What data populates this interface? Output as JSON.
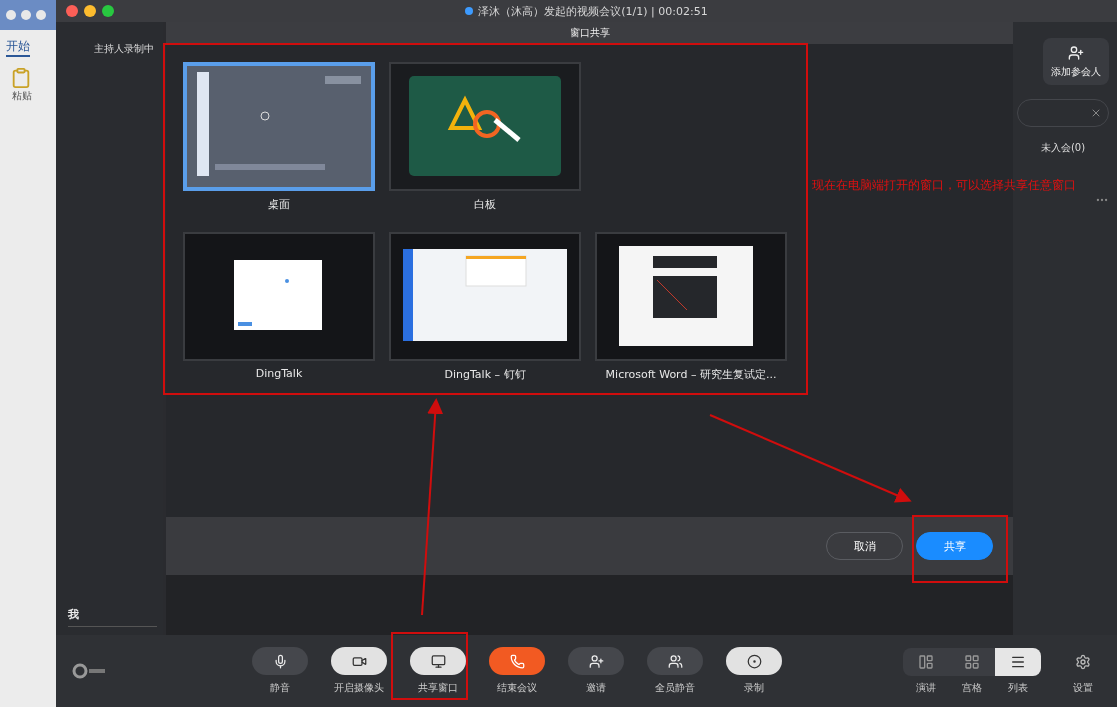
{
  "word_app": {
    "tab": "开始",
    "paste_label": "粘贴"
  },
  "window": {
    "title": "泽沐（沐高）发起的视频会议(1/1) | 00:02:51"
  },
  "left_pane": {
    "recording_status": "主持人录制中",
    "self_name": "我"
  },
  "share_dialog": {
    "title": "窗口共享",
    "sources": [
      {
        "label": "桌面",
        "kind": "desktop",
        "selected": true
      },
      {
        "label": "白板",
        "kind": "whiteboard",
        "selected": false
      },
      {
        "label": "DingTalk",
        "kind": "dialog",
        "selected": false
      },
      {
        "label": "DingTalk – 钉钉",
        "kind": "chat",
        "selected": false
      },
      {
        "label": "Microsoft Word – 研究生复试定...",
        "kind": "document",
        "selected": false
      }
    ],
    "buttons": [
      {
        "label": "取消",
        "kind": "secondary"
      },
      {
        "label": "共享",
        "kind": "primary"
      }
    ]
  },
  "participants_panel": {
    "add_button": "添加参会人",
    "tab": "未入会(0)"
  },
  "toolbar": {
    "controls": [
      {
        "label": "静音",
        "kind": "mute",
        "on": false
      },
      {
        "label": "开启摄像头",
        "kind": "camera",
        "on": true
      },
      {
        "label": "共享窗口",
        "kind": "share",
        "on": true
      },
      {
        "label": "结束会议",
        "kind": "end"
      },
      {
        "label": "邀请",
        "kind": "invite",
        "on": false
      },
      {
        "label": "全员静音",
        "kind": "mute_all",
        "on": false
      },
      {
        "label": "录制",
        "kind": "record",
        "on": true
      }
    ],
    "views": [
      {
        "label": "演讲",
        "kind": "speaker",
        "selected": false
      },
      {
        "label": "宫格",
        "kind": "grid",
        "selected": false
      },
      {
        "label": "列表",
        "kind": "list",
        "selected": true
      }
    ],
    "settings": "设置"
  },
  "annotation": {
    "note": "现在在电脑端打开的窗口，可以选择共享任意窗口"
  }
}
